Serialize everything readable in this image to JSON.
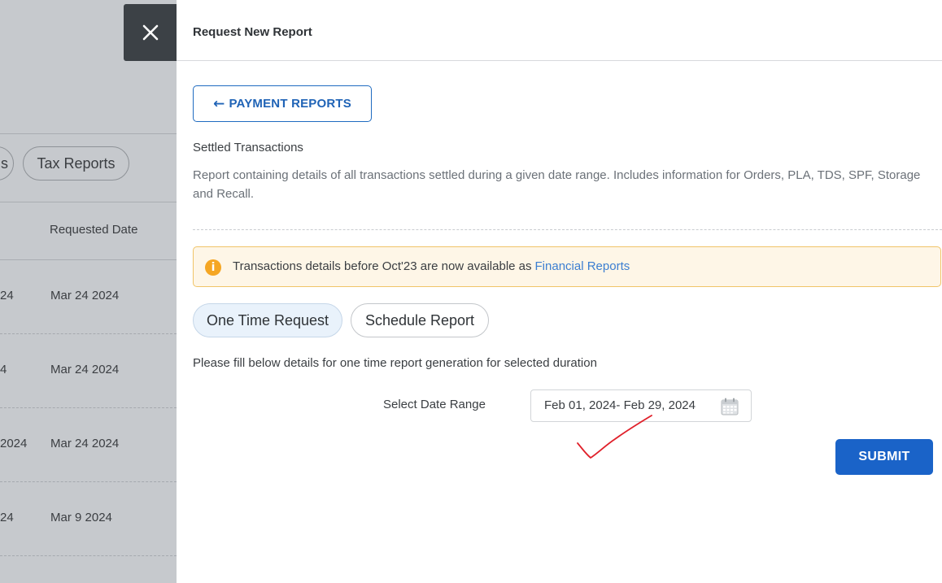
{
  "background": {
    "chips": [
      {
        "label": "s"
      },
      {
        "label": "Tax Reports"
      }
    ],
    "column_header": "Requested Date",
    "rows": [
      {
        "left": "24",
        "date": "Mar 24 2024"
      },
      {
        "left": "4",
        "date": "Mar 24 2024"
      },
      {
        "left": "2024",
        "date": "Mar 24 2024"
      },
      {
        "left": "24",
        "date": "Mar 9 2024"
      }
    ]
  },
  "panel": {
    "title": "Request New Report",
    "back_button": {
      "arrow": "←",
      "label": "PAYMENT REPORTS"
    },
    "report_name": "Settled Transactions",
    "report_description": "Report containing details of all transactions settled during a given date range. Includes information for Orders, PLA, TDS, SPF, Storage and Recall.",
    "info": {
      "text": "Transactions details before Oct'23 are now available as",
      "link": "Financial Reports",
      "icon": "info-icon"
    },
    "tabs": [
      {
        "label": "One Time Request",
        "active": true
      },
      {
        "label": "Schedule Report",
        "active": false
      }
    ],
    "fill_note": "Please fill below details for one time report generation for selected duration",
    "date_range": {
      "label": "Select Date Range",
      "value": "Feb 01, 2024- Feb 29, 2024",
      "icon": "calendar-icon"
    },
    "submit_label": "SUBMIT"
  },
  "colors": {
    "primary": "#1a63c8",
    "link": "#3c7fd1",
    "info_bg": "#fef6e7",
    "info_border": "#f0c468",
    "info_icon": "#f5a623",
    "annotation": "#e0202a"
  }
}
